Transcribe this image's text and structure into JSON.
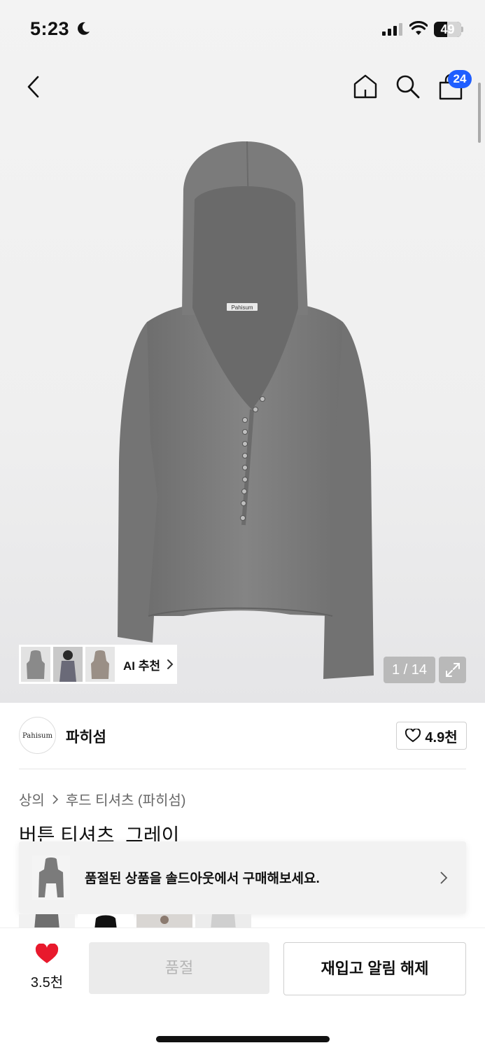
{
  "status_bar": {
    "time": "5:23",
    "battery": "49",
    "battery_level": 0.49
  },
  "nav": {
    "cart_count": "24"
  },
  "ai_recommend": {
    "label": "AI 추천"
  },
  "gallery": {
    "counter": "1 / 14",
    "current": 1,
    "total": 14
  },
  "brand": {
    "logo_text": "Pahisum",
    "name": "파히섬",
    "likes": "4.9천"
  },
  "breadcrumb": {
    "category": "상의",
    "subcategory": "후드 티셔츠 (파히섬)"
  },
  "product": {
    "title": "버튼 티셔츠_그레이",
    "garment_label": "Pahisum"
  },
  "soldout_banner": {
    "text": "품절된 상품을 솔드아웃에서 구매해보세요."
  },
  "bottom_bar": {
    "heart_count": "3.5천",
    "soldout_label": "품절",
    "restock_label": "재입고 알림 해제"
  },
  "colors": {
    "accent": "#1f5eff",
    "heart": "#e8192c",
    "garment": "#7a7a7a"
  },
  "icons": [
    "moon-icon",
    "signal-icon",
    "wifi-icon",
    "battery-icon",
    "back-icon",
    "home-icon",
    "search-icon",
    "shopping-bag-icon",
    "chevron-right-icon",
    "expand-icon",
    "heart-outline-icon",
    "heart-filled-icon"
  ]
}
